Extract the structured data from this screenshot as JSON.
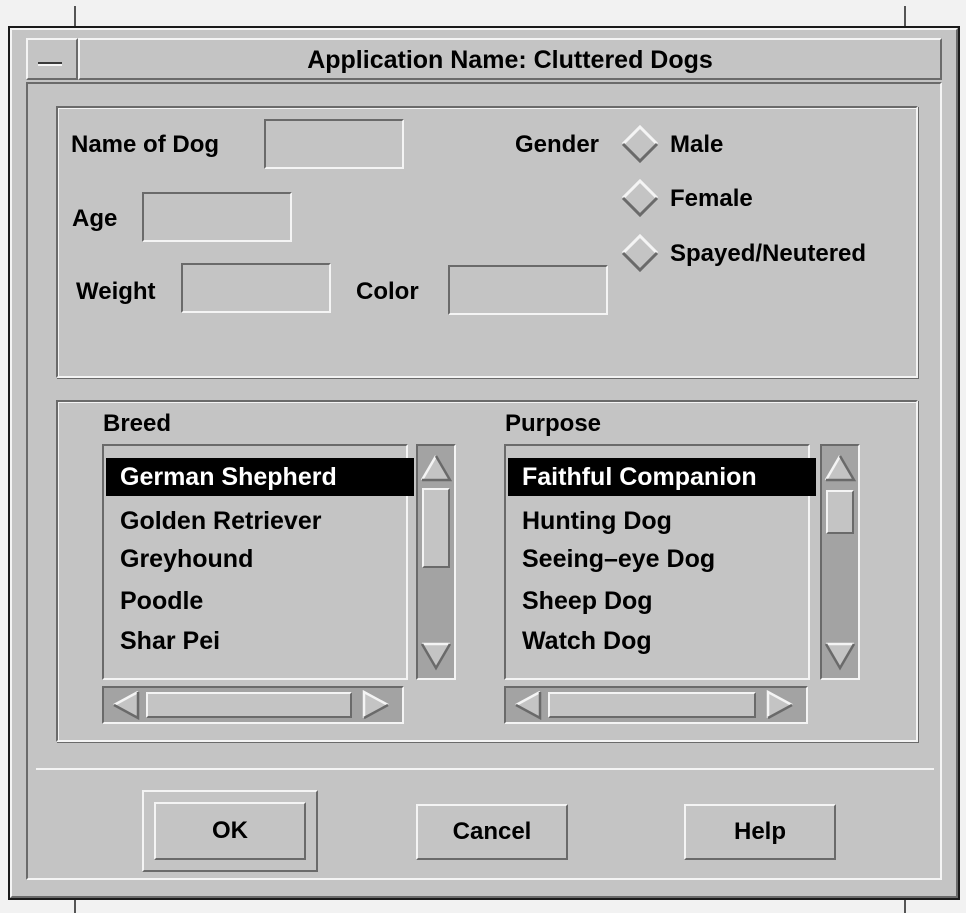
{
  "window": {
    "title": "Application Name: Cluttered Dogs",
    "menu_glyph": "–"
  },
  "form": {
    "name_label": "Name of Dog",
    "name_value": "",
    "age_label": "Age",
    "age_value": "",
    "weight_label": "Weight",
    "weight_value": "",
    "color_label": "Color",
    "color_value": "",
    "gender_label": "Gender",
    "gender_options": [
      "Male",
      "Female",
      "Spayed/Neutered"
    ]
  },
  "breed": {
    "label": "Breed",
    "items": [
      "German Shepherd",
      "Golden Retriever",
      "Greyhound",
      "Poodle",
      "Shar Pei"
    ],
    "selected": "German Shepherd"
  },
  "purpose": {
    "label": "Purpose",
    "items": [
      "Faithful Companion",
      "Hunting Dog",
      "Seeing–eye Dog",
      "Sheep Dog",
      "Watch Dog"
    ],
    "selected": "Faithful Companion"
  },
  "buttons": {
    "ok": "OK",
    "cancel": "Cancel",
    "help": "Help"
  },
  "colors": {
    "background": "#c4c4c4",
    "trough": "#a3a3a3",
    "selection": "#000000",
    "selection_text": "#ffffff"
  },
  "icons": {
    "window_menu": "window-menu-icon",
    "arrow_up": "arrow-up-icon",
    "arrow_down": "arrow-down-icon",
    "arrow_left": "arrow-left-icon",
    "arrow_right": "arrow-right-icon",
    "radio": "diamond-radio-icon"
  }
}
